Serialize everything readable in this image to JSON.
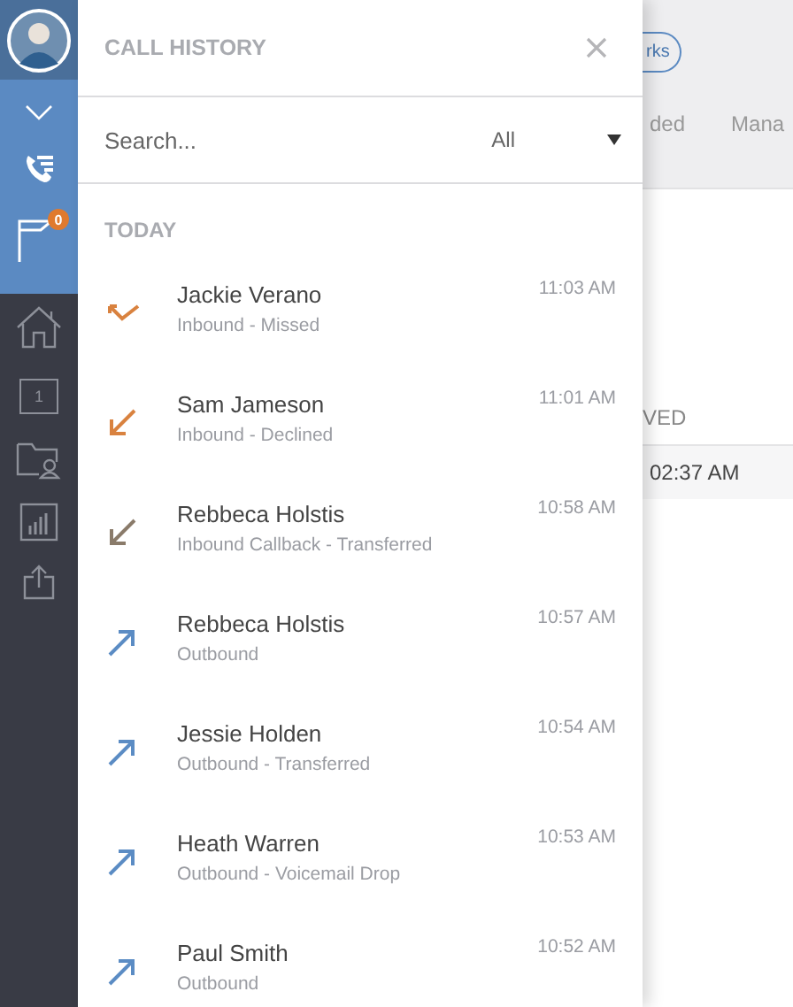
{
  "sidebar": {
    "badge": "0",
    "calendar_day": "1"
  },
  "panel": {
    "title": "CALL HISTORY",
    "search": {
      "placeholder": "Search..."
    },
    "filter": "All",
    "section": "TODAY",
    "calls": [
      {
        "name": "Jackie Verano",
        "detail": "Inbound - Missed",
        "time": "11:03 AM",
        "kind": "missed"
      },
      {
        "name": "Sam Jameson",
        "detail": "Inbound - Declined",
        "time": "11:01 AM",
        "kind": "declined"
      },
      {
        "name": "Rebbeca Holstis",
        "detail": "Inbound Callback - Transferred",
        "time": "10:58 AM",
        "kind": "callback"
      },
      {
        "name": "Rebbeca Holstis",
        "detail": "Outbound",
        "time": "10:57 AM",
        "kind": "outbound"
      },
      {
        "name": "Jessie Holden",
        "detail": "Outbound - Transferred",
        "time": "10:54 AM",
        "kind": "outbound"
      },
      {
        "name": "Heath Warren",
        "detail": "Outbound - Voicemail Drop",
        "time": "10:53 AM",
        "kind": "outbound"
      },
      {
        "name": "Paul Smith",
        "detail": "Outbound",
        "time": "10:52 AM",
        "kind": "outbound"
      }
    ]
  },
  "background": {
    "button": "rks",
    "tabs": [
      "ded",
      "Mana"
    ],
    "column": "VED",
    "cell": "02:37 AM"
  }
}
